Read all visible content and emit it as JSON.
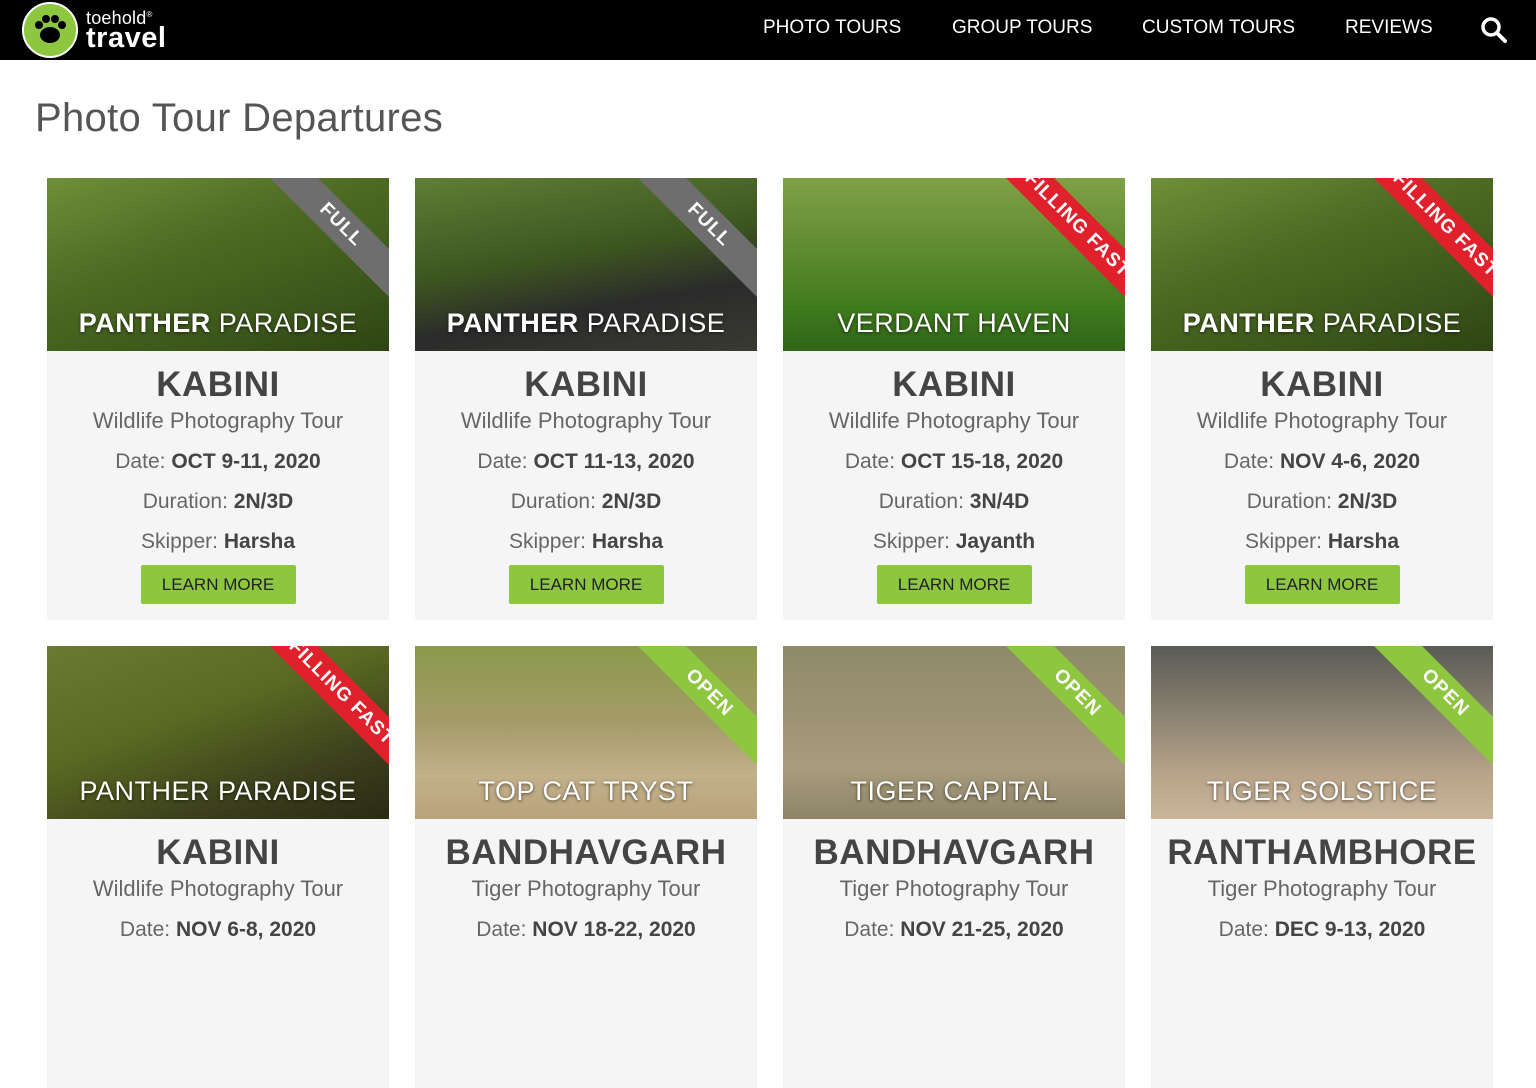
{
  "brand": {
    "small": "toehold",
    "mark": "®",
    "big": "travel"
  },
  "nav": [
    {
      "label": "PHOTO TOURS"
    },
    {
      "label": "GROUP TOURS"
    },
    {
      "label": "CUSTOM TOURS"
    },
    {
      "label": "REVIEWS"
    }
  ],
  "icons": {
    "search": "search-icon",
    "logo": "paw-icon"
  },
  "page": {
    "title": "Photo Tour Departures"
  },
  "labels": {
    "date": "Date:",
    "duration": "Duration:",
    "skipper": "Skipper:",
    "learn_more": "LEARN MORE"
  },
  "colors": {
    "accent": "#8dc63f",
    "full": "#6e6e6e",
    "filling_fast": "#e0202a",
    "open": "#8dc63f"
  },
  "cards": [
    {
      "title_bold": "PANTHER",
      "title_rest": " PARADISE",
      "badge": "FULL",
      "badge_type": "full",
      "image": "leopards-on-tree",
      "location": "KABINI",
      "tour_type": "Wildlife Photography Tour",
      "date": "OCT 9-11, 2020",
      "duration": "2N/3D",
      "skipper": "Harsha"
    },
    {
      "title_bold": "PANTHER",
      "title_rest": " PARADISE",
      "badge": "FULL",
      "badge_type": "full",
      "image": "black-panther-on-rock",
      "location": "KABINI",
      "tour_type": "Wildlife Photography Tour",
      "date": "OCT 11-13, 2020",
      "duration": "2N/3D",
      "skipper": "Harsha"
    },
    {
      "title_bold": "",
      "title_rest": "VERDANT HAVEN",
      "badge": "FILLING FAST",
      "badge_type": "filling_fast",
      "image": "leopard-in-grass",
      "location": "KABINI",
      "tour_type": "Wildlife Photography Tour",
      "date": "OCT 15-18, 2020",
      "duration": "3N/4D",
      "skipper": "Jayanth"
    },
    {
      "title_bold": "PANTHER",
      "title_rest": " PARADISE",
      "badge": "FILLING FAST",
      "badge_type": "filling_fast",
      "image": "leopards-on-tree",
      "location": "KABINI",
      "tour_type": "Wildlife Photography Tour",
      "date": "NOV 4-6, 2020",
      "duration": "2N/3D",
      "skipper": "Harsha"
    },
    {
      "title_bold": "",
      "title_rest": "PANTHER PARADISE",
      "badge": "FILLING FAST",
      "badge_type": "filling_fast",
      "image": "leopard-on-branch",
      "location": "KABINI",
      "tour_type": "Wildlife Photography Tour",
      "date": "NOV 6-8, 2020",
      "duration": "",
      "skipper": ""
    },
    {
      "title_bold": "",
      "title_rest": "TOP CAT TRYST",
      "badge": "OPEN",
      "badge_type": "open",
      "image": "tiger-walking-path",
      "location": "BANDHAVGARH",
      "tour_type": "Tiger Photography Tour",
      "date": "NOV 18-22, 2020",
      "duration": "",
      "skipper": ""
    },
    {
      "title_bold": "",
      "title_rest": "TIGER CAPITAL",
      "badge": "OPEN",
      "badge_type": "open",
      "image": "tiger-standing-grass",
      "location": "BANDHAVGARH",
      "tour_type": "Tiger Photography Tour",
      "date": "NOV 21-25, 2020",
      "duration": "",
      "skipper": ""
    },
    {
      "title_bold": "",
      "title_rest": "TIGER SOLSTICE",
      "badge": "OPEN",
      "badge_type": "open",
      "image": "tiger-lying-ground",
      "location": "RANTHAMBHORE",
      "tour_type": "Tiger Photography Tour",
      "date": "DEC 9-13, 2020",
      "duration": "",
      "skipper": ""
    }
  ]
}
